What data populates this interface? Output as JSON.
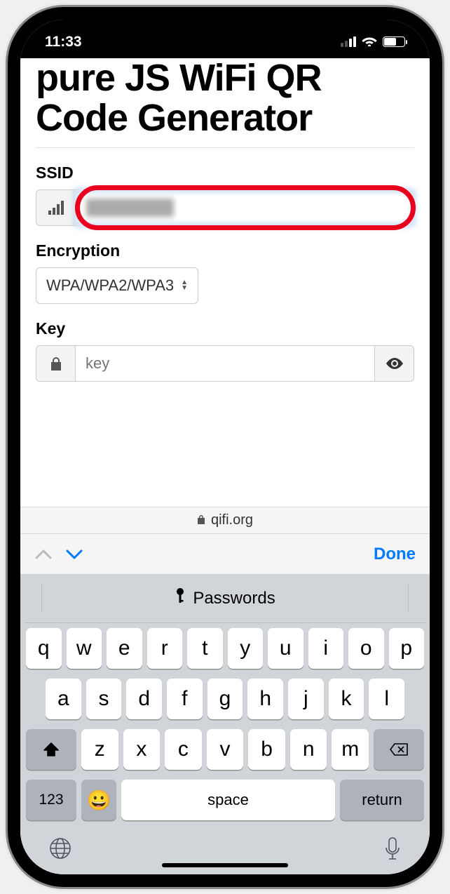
{
  "status_bar": {
    "time": "11:33"
  },
  "page": {
    "title": "pure JS WiFi QR Code Generator"
  },
  "form": {
    "ssid_label": "SSID",
    "ssid_value": "████████",
    "encryption_label": "Encryption",
    "encryption_value": "WPA/WPA2/WPA3",
    "key_label": "Key",
    "key_placeholder": "key"
  },
  "url_bar": {
    "domain": "qifi.org"
  },
  "keyboard": {
    "done": "Done",
    "passwords": "Passwords",
    "row1": [
      "q",
      "w",
      "e",
      "r",
      "t",
      "y",
      "u",
      "i",
      "o",
      "p"
    ],
    "row2": [
      "a",
      "s",
      "d",
      "f",
      "g",
      "h",
      "j",
      "k",
      "l"
    ],
    "row3": [
      "z",
      "x",
      "c",
      "v",
      "b",
      "n",
      "m"
    ],
    "numbers": "123",
    "space": "space",
    "return": "return"
  }
}
